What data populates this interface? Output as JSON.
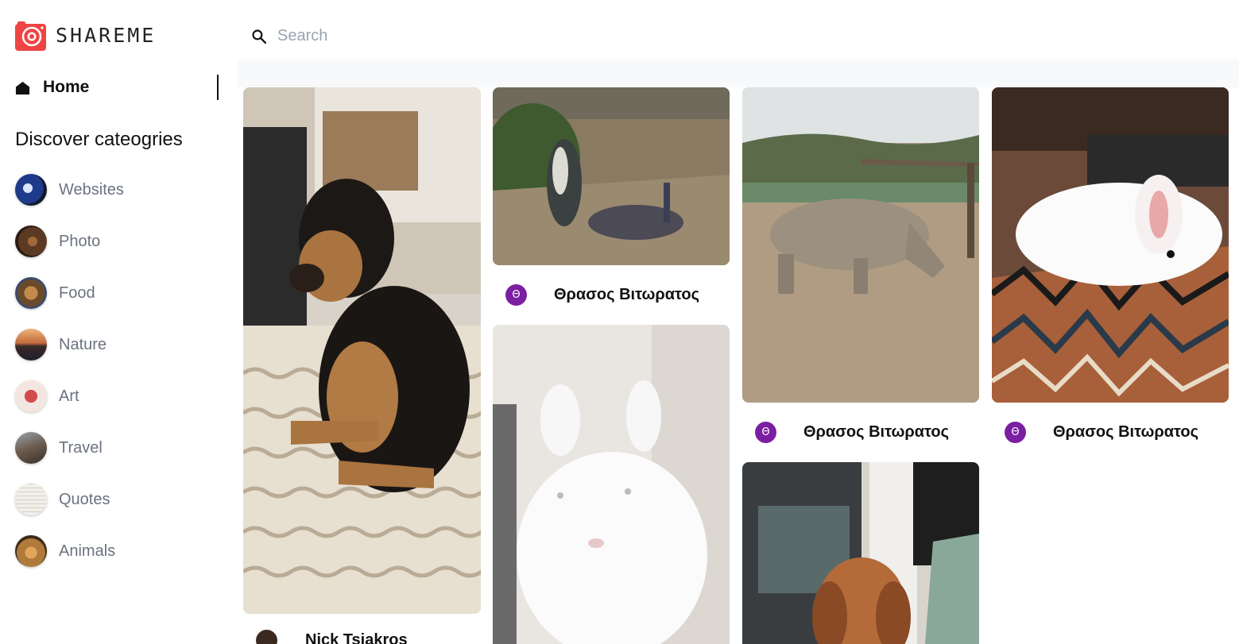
{
  "app": {
    "name": "SHAREME",
    "accent": "#ef4444"
  },
  "nav": {
    "home_label": "Home"
  },
  "categories": {
    "heading": "Discover cateogries",
    "items": [
      {
        "label": "Websites",
        "color": "#1e3a8a"
      },
      {
        "label": "Photo",
        "color": "#5b3a24"
      },
      {
        "label": "Food",
        "color": "#8a6a3a"
      },
      {
        "label": "Nature",
        "color": "#c26b3c"
      },
      {
        "label": "Art",
        "color": "#d14b4b"
      },
      {
        "label": "Travel",
        "color": "#6b5b4e"
      },
      {
        "label": "Quotes",
        "color": "#e5e0d8"
      },
      {
        "label": "Animals",
        "color": "#b07a3a"
      }
    ]
  },
  "search": {
    "placeholder": "Search",
    "value": ""
  },
  "pins": [
    {
      "subject": "dog sitting on foam mattress",
      "author": "Nick Tsiakros",
      "avatar_initial": ""
    },
    {
      "subject": "peacocks on dirt ground",
      "author": "Θρασος Βιτωρατος",
      "avatar_initial": "Θ"
    },
    {
      "subject": "white fluffy rabbit",
      "author": "",
      "avatar_initial": ""
    },
    {
      "subject": "rhinoceros in enclosure",
      "author": "Θρασος Βιτωρατος",
      "avatar_initial": "Θ"
    },
    {
      "subject": "dog in kitchen",
      "author": "",
      "avatar_initial": ""
    },
    {
      "subject": "white rabbit on patterned rug",
      "author": "Θρασος Βιτωρατος",
      "avatar_initial": "Θ"
    }
  ]
}
